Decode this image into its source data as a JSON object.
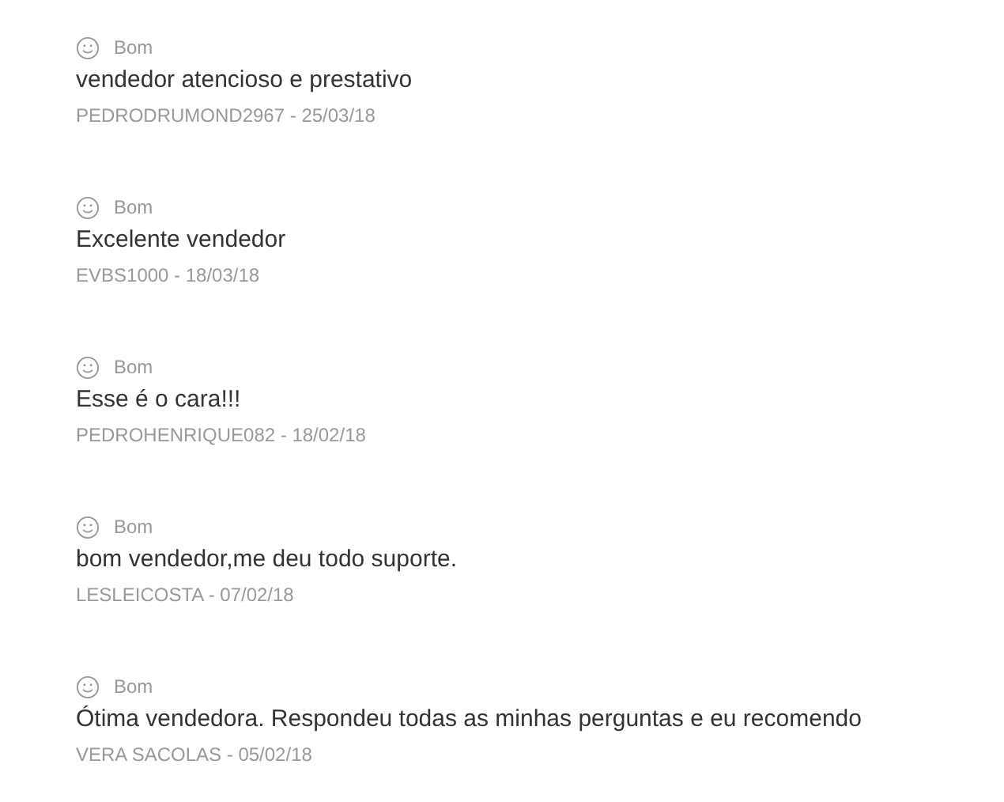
{
  "reviews": [
    {
      "rating": {
        "kind": "good",
        "label": "Bom"
      },
      "comment": "vendedor atencioso e prestativo",
      "author": "PEDRODRUMOND2967 - 25/03/18"
    },
    {
      "rating": {
        "kind": "good",
        "label": "Bom"
      },
      "comment": "Excelente vendedor",
      "author": "EVBS1000 - 18/03/18"
    },
    {
      "rating": {
        "kind": "good",
        "label": "Bom"
      },
      "comment": "Esse é o cara!!!",
      "author": "PEDROHENRIQUE082 - 18/02/18"
    },
    {
      "rating": {
        "kind": "good",
        "label": "Bom"
      },
      "comment": "bom vendedor,me deu todo suporte.",
      "author": "LESLEICOSTA - 07/02/18"
    },
    {
      "rating": {
        "kind": "good",
        "label": "Bom"
      },
      "comment": "Ótima vendedora. Respondeu todas as minhas perguntas e eu recomendo",
      "author": "VERA SACOLAS - 05/02/18"
    }
  ]
}
